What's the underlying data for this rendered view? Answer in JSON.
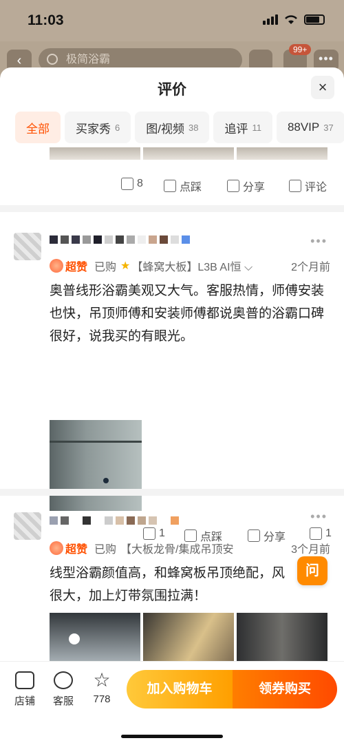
{
  "status": {
    "time": "11:03"
  },
  "bg_header": {
    "search_placeholder": "极简浴霸",
    "cart_badge": "99+"
  },
  "sheet": {
    "title": "评价",
    "close": "×"
  },
  "tabs": [
    {
      "label": "全部",
      "count": ""
    },
    {
      "label": "买家秀",
      "count": "6"
    },
    {
      "label": "图/视频",
      "count": "38"
    },
    {
      "label": "追评",
      "count": "11"
    },
    {
      "label": "88VIP",
      "count": "37"
    }
  ],
  "prev_actions": {
    "like": "8",
    "dislike": "点踩",
    "share": "分享",
    "comment": "评论"
  },
  "reviews": [
    {
      "badge": "超赞",
      "bought": "已购",
      "sku": "【蜂窝大板】L3B AI恒",
      "ago": "2个月前",
      "content": "奥普线形浴霸美观又大气。客服热情，师傅安装也快，吊顶师傅和安装师傅都说奥普的浴霸口碑很好，说我买的有眼光。",
      "actions": {
        "like": "1",
        "dislike": "点踩",
        "share": "分享",
        "comment": "1"
      }
    },
    {
      "badge": "超赞",
      "bought": "已购",
      "sku": "【大板龙骨/集成吊顶安",
      "ago": "3个月前",
      "content": "线型浴霸颜值高，和蜂窝板吊顶绝配，风很大，加上灯带氛围拉满！"
    }
  ],
  "ask_bubble": "问",
  "bottom": {
    "store": "店铺",
    "service": "客服",
    "fav_count": "778",
    "add_cart": "加入购物车",
    "buy": "领券购买"
  },
  "colors": {
    "accent": "#ff5000",
    "cart_gradient": "#ffc93a",
    "buy_gradient": "#ff4a00"
  }
}
